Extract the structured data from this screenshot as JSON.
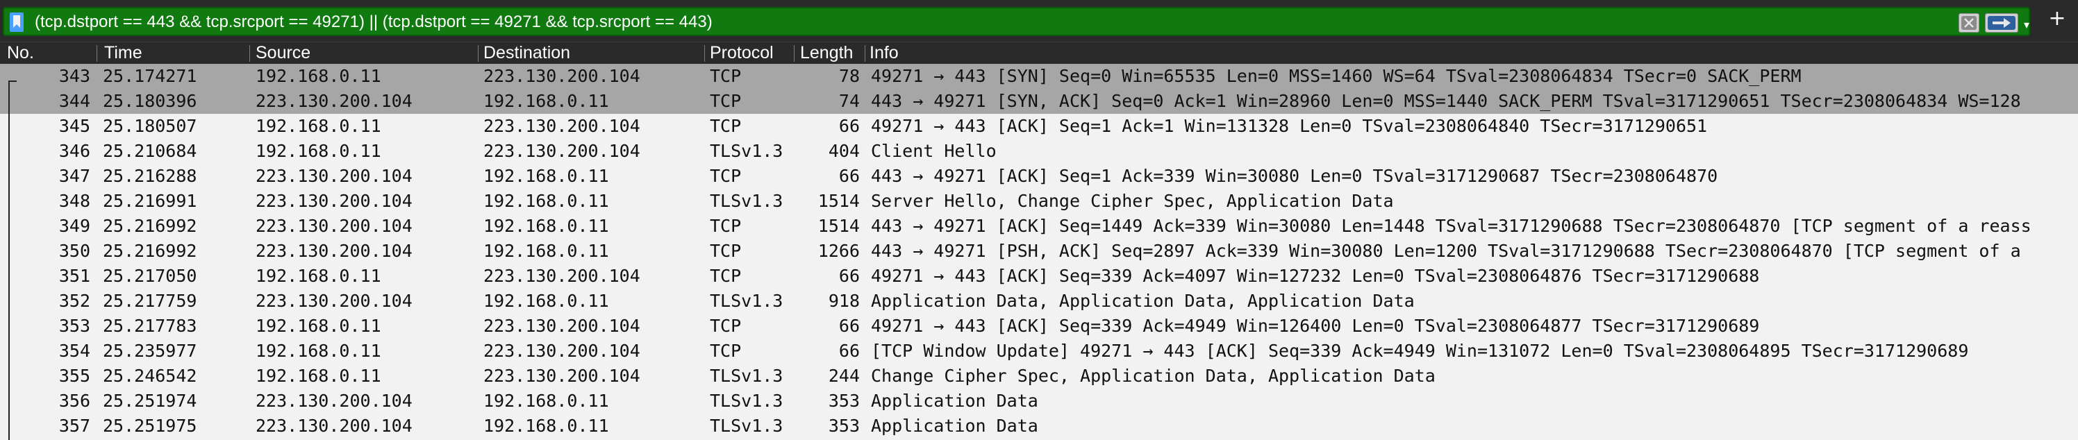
{
  "filter": {
    "text": "(tcp.dstport == 443 && tcp.srcport == 49271) || (tcp.dstport == 49271 && tcp.srcport == 443)",
    "bookmark_icon": "bookmark-icon",
    "clear_icon": "clear-icon",
    "apply_icon": "arrow-right-icon",
    "dropdown_glyph": "▾",
    "add_glyph": "+",
    "accent_color": "#107a10"
  },
  "columns": {
    "no": "No.",
    "time": "Time",
    "source": "Source",
    "destination": "Destination",
    "protocol": "Protocol",
    "length": "Length",
    "info": "Info"
  },
  "selected_color": "#a6a6a6",
  "packets": [
    {
      "no": "343",
      "time": "25.174271",
      "source": "192.168.0.11",
      "destination": "223.130.200.104",
      "protocol": "TCP",
      "length": "78",
      "info": "49271 → 443 [SYN] Seq=0 Win=65535 Len=0 MSS=1460 WS=64 TSval=2308064834 TSecr=0 SACK_PERM",
      "selected": true
    },
    {
      "no": "344",
      "time": "25.180396",
      "source": "223.130.200.104",
      "destination": "192.168.0.11",
      "protocol": "TCP",
      "length": "74",
      "info": "443 → 49271 [SYN, ACK] Seq=0 Ack=1 Win=28960 Len=0 MSS=1440 SACK_PERM TSval=3171290651 TSecr=2308064834 WS=128",
      "selected": true
    },
    {
      "no": "345",
      "time": "25.180507",
      "source": "192.168.0.11",
      "destination": "223.130.200.104",
      "protocol": "TCP",
      "length": "66",
      "info": "49271 → 443 [ACK] Seq=1 Ack=1 Win=131328 Len=0 TSval=2308064840 TSecr=3171290651",
      "selected": false
    },
    {
      "no": "346",
      "time": "25.210684",
      "source": "192.168.0.11",
      "destination": "223.130.200.104",
      "protocol": "TLSv1.3",
      "length": "404",
      "info": "Client Hello",
      "selected": false
    },
    {
      "no": "347",
      "time": "25.216288",
      "source": "223.130.200.104",
      "destination": "192.168.0.11",
      "protocol": "TCP",
      "length": "66",
      "info": "443 → 49271 [ACK] Seq=1 Ack=339 Win=30080 Len=0 TSval=3171290687 TSecr=2308064870",
      "selected": false
    },
    {
      "no": "348",
      "time": "25.216991",
      "source": "223.130.200.104",
      "destination": "192.168.0.11",
      "protocol": "TLSv1.3",
      "length": "1514",
      "info": "Server Hello, Change Cipher Spec, Application Data",
      "selected": false
    },
    {
      "no": "349",
      "time": "25.216992",
      "source": "223.130.200.104",
      "destination": "192.168.0.11",
      "protocol": "TCP",
      "length": "1514",
      "info": "443 → 49271 [ACK] Seq=1449 Ack=339 Win=30080 Len=1448 TSval=3171290688 TSecr=2308064870 [TCP segment of a reass",
      "selected": false
    },
    {
      "no": "350",
      "time": "25.216992",
      "source": "223.130.200.104",
      "destination": "192.168.0.11",
      "protocol": "TCP",
      "length": "1266",
      "info": "443 → 49271 [PSH, ACK] Seq=2897 Ack=339 Win=30080 Len=1200 TSval=3171290688 TSecr=2308064870 [TCP segment of a",
      "selected": false
    },
    {
      "no": "351",
      "time": "25.217050",
      "source": "192.168.0.11",
      "destination": "223.130.200.104",
      "protocol": "TCP",
      "length": "66",
      "info": "49271 → 443 [ACK] Seq=339 Ack=4097 Win=127232 Len=0 TSval=2308064876 TSecr=3171290688",
      "selected": false
    },
    {
      "no": "352",
      "time": "25.217759",
      "source": "223.130.200.104",
      "destination": "192.168.0.11",
      "protocol": "TLSv1.3",
      "length": "918",
      "info": "Application Data, Application Data, Application Data",
      "selected": false
    },
    {
      "no": "353",
      "time": "25.217783",
      "source": "192.168.0.11",
      "destination": "223.130.200.104",
      "protocol": "TCP",
      "length": "66",
      "info": "49271 → 443 [ACK] Seq=339 Ack=4949 Win=126400 Len=0 TSval=2308064877 TSecr=3171290689",
      "selected": false
    },
    {
      "no": "354",
      "time": "25.235977",
      "source": "192.168.0.11",
      "destination": "223.130.200.104",
      "protocol": "TCP",
      "length": "66",
      "info": "[TCP Window Update] 49271 → 443 [ACK] Seq=339 Ack=4949 Win=131072 Len=0 TSval=2308064895 TSecr=3171290689",
      "selected": false
    },
    {
      "no": "355",
      "time": "25.246542",
      "source": "192.168.0.11",
      "destination": "223.130.200.104",
      "protocol": "TLSv1.3",
      "length": "244",
      "info": "Change Cipher Spec, Application Data, Application Data",
      "selected": false
    },
    {
      "no": "356",
      "time": "25.251974",
      "source": "223.130.200.104",
      "destination": "192.168.0.11",
      "protocol": "TLSv1.3",
      "length": "353",
      "info": "Application Data",
      "selected": false
    },
    {
      "no": "357",
      "time": "25.251975",
      "source": "223.130.200.104",
      "destination": "192.168.0.11",
      "protocol": "TLSv1.3",
      "length": "353",
      "info": "Application Data",
      "selected": false
    }
  ]
}
